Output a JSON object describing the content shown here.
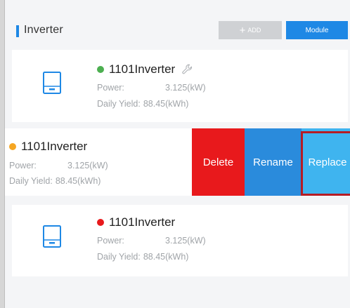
{
  "header": {
    "title": "Inverter",
    "add_label": "ADD",
    "module_label": "Module"
  },
  "devices": [
    {
      "name": "1101Inverter",
      "status_color": "#4caf50",
      "power_label": "Power:",
      "power_value": "3.125(kW)",
      "yield_label": "Daily Yield:",
      "yield_value": "88.45(kWh)",
      "icon": "inverter-device-icon",
      "has_settings_icon": true
    },
    {
      "name": "1101Inverter",
      "status_color": "#f5a623",
      "power_label": "Power:",
      "power_value": "3.125(kW)",
      "yield_label": "Daily Yield:",
      "yield_value": "88.45(kWh)",
      "swiped": true
    },
    {
      "name": "1101Inverter",
      "status_color": "#e8191c",
      "power_label": "Power:",
      "power_value": "3.125(kW)",
      "yield_label": "Daily Yield:",
      "yield_value": "88.45(kWh)",
      "icon": "inverter-device-icon"
    }
  ],
  "swipe_actions": {
    "delete": "Delete",
    "rename": "Rename",
    "replace": "Replace"
  },
  "colors": {
    "accent": "#1e88e5",
    "delete": "#e8191c",
    "rename": "#2a8bdc",
    "replace": "#3fb4ef",
    "highlight": "#b51c24",
    "disabled": "#cfd1d4"
  }
}
